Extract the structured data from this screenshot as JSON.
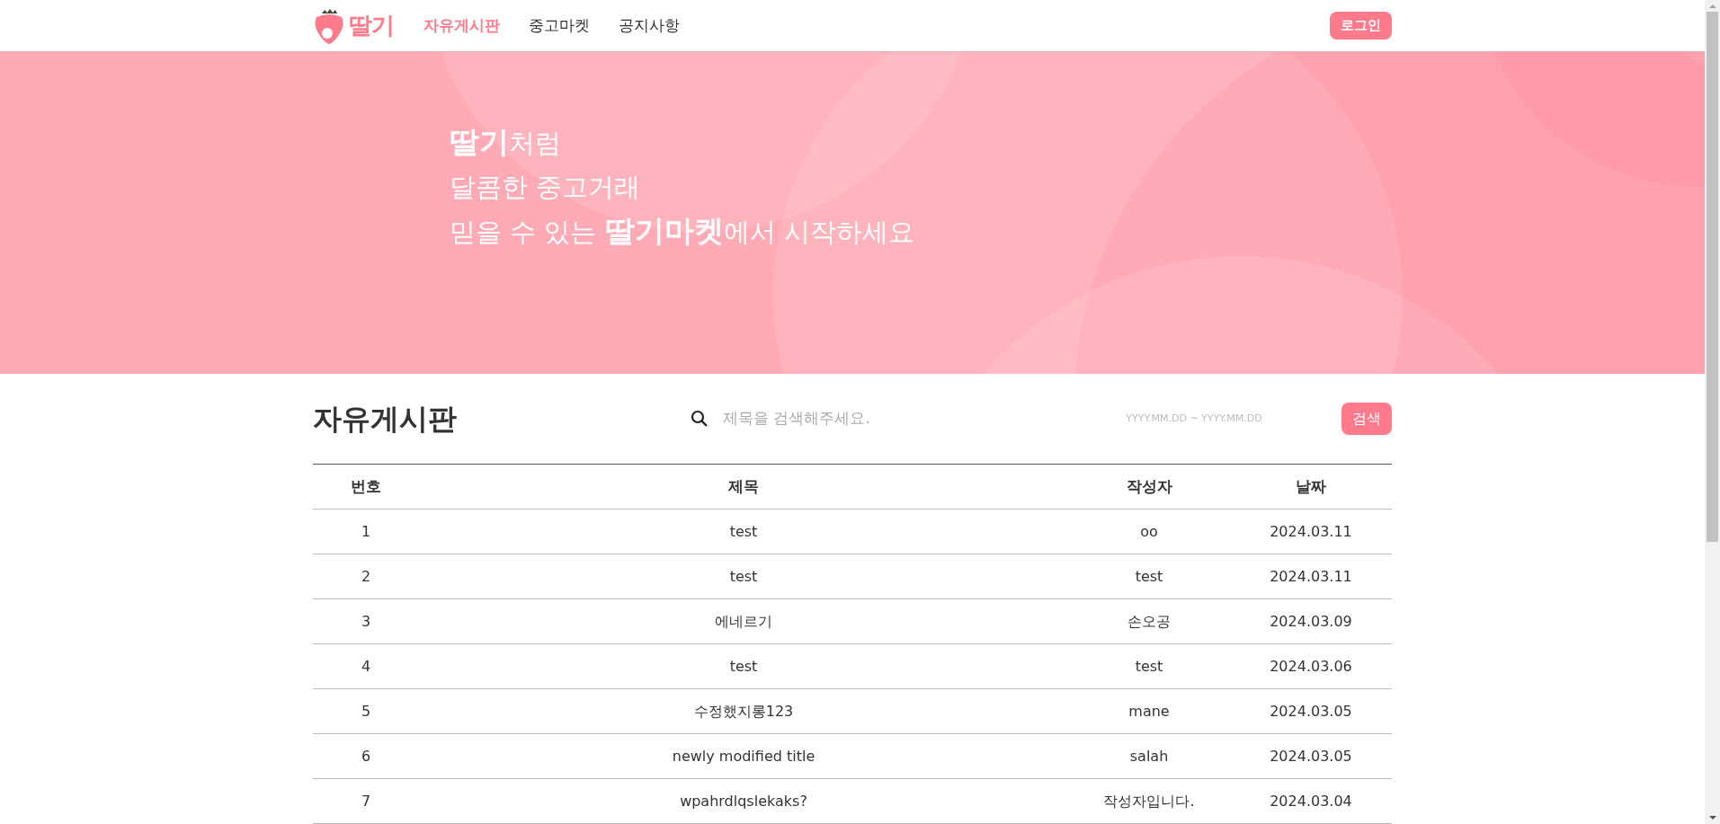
{
  "header": {
    "logo": "딸기",
    "nav": [
      {
        "label": "자유게시판",
        "selected": true
      },
      {
        "label": "중고마켓",
        "selected": false
      },
      {
        "label": "공지사항",
        "selected": false
      }
    ],
    "login_button": "로그인"
  },
  "hero": {
    "lines": [
      "**딸기**처럼",
      "달콤한 중고거래",
      "믿을 수 있는 **딸기마켓**에서 시작하세요"
    ]
  },
  "board": {
    "title": "자유게시판",
    "search": {
      "placeholder": "제목을 검색해주세요."
    },
    "date_range": {
      "placeholder": "YYYY.MM.DD ~ YYYY.MM.DD"
    },
    "search_button": "검색"
  },
  "table": {
    "columns": [
      "번호",
      "제목",
      "작성자",
      "날짜"
    ],
    "rows": [
      [
        "1",
        "test",
        "oo",
        "2024.03.11"
      ],
      [
        "2",
        "test",
        "test",
        "2024.03.11"
      ],
      [
        "3",
        "에네르기",
        "손오공",
        "2024.03.09"
      ],
      [
        "4",
        "test",
        "test",
        "2024.03.06"
      ],
      [
        "5",
        "수정했지롱123",
        "mane",
        "2024.03.05"
      ],
      [
        "6",
        "newly modified title",
        "salah",
        "2024.03.05"
      ],
      [
        "7",
        "wpahrdlqslekaks?",
        "작성자입니다.",
        "2024.03.04"
      ]
    ]
  }
}
